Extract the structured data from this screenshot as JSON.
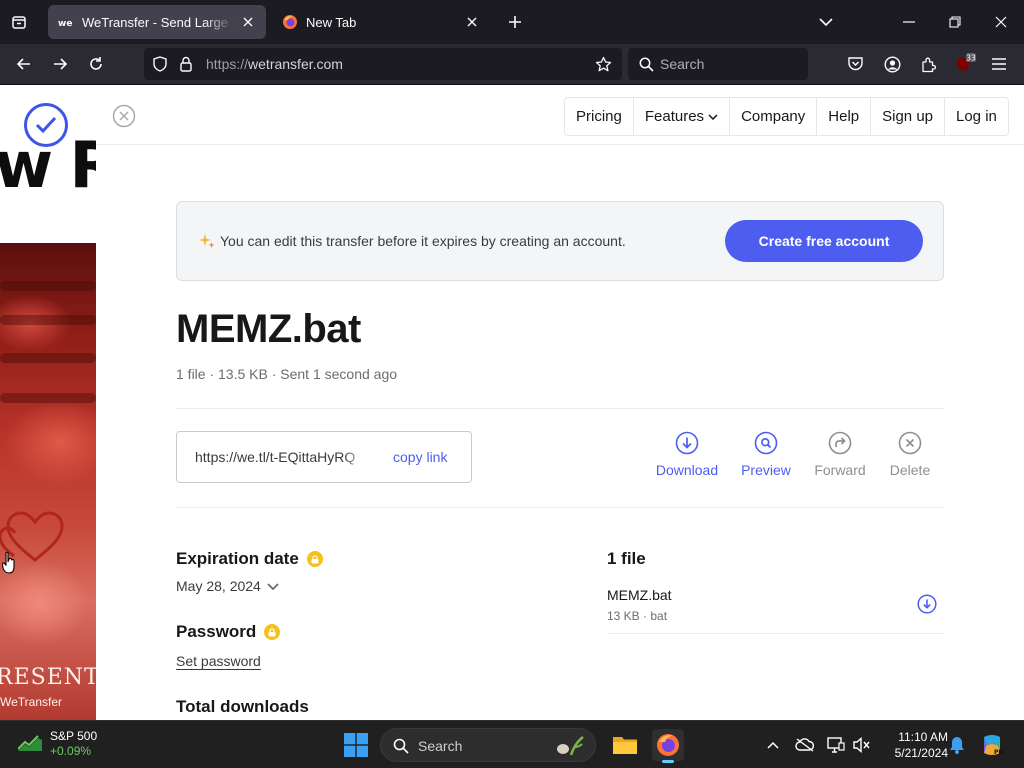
{
  "browser": {
    "tabs": [
      {
        "title": "WeTransfer - Send Large Files & Share Photos Online",
        "active": true,
        "favicon": "wetransfer-favicon"
      },
      {
        "title": "New Tab",
        "active": false,
        "favicon": "firefox-icon"
      }
    ],
    "url_scheme": "https://",
    "url_host": "wetransfer.com",
    "search_placeholder": "Search",
    "extensions_badge": "33"
  },
  "background": {
    "headline_fragment": "w R",
    "present_text": "RESENT",
    "present_sub": "WeTransfer"
  },
  "nav": {
    "items": [
      {
        "label": "Pricing",
        "has_dropdown": false
      },
      {
        "label": "Features",
        "has_dropdown": true
      },
      {
        "label": "Company",
        "has_dropdown": false
      },
      {
        "label": "Help",
        "has_dropdown": false
      },
      {
        "label": "Sign up",
        "has_dropdown": false
      },
      {
        "label": "Log in",
        "has_dropdown": false
      }
    ]
  },
  "banner": {
    "message": "You can edit this transfer before it expires by creating an account.",
    "cta": "Create free account"
  },
  "transfer": {
    "title": "MEMZ.bat",
    "meta": "1 file · 13.5 KB · Sent 1 second ago",
    "link": "https://we.tl/t-EQittaHyRQ",
    "copy_label": "copy link",
    "actions": [
      {
        "label": "Download",
        "icon": "download-icon",
        "enabled": true
      },
      {
        "label": "Preview",
        "icon": "preview-icon",
        "enabled": true
      },
      {
        "label": "Forward",
        "icon": "forward-icon",
        "enabled": false
      },
      {
        "label": "Delete",
        "icon": "delete-icon",
        "enabled": false
      }
    ]
  },
  "details": {
    "expiration_label": "Expiration date",
    "expiration_value": "May 28, 2024",
    "password_label": "Password",
    "password_action": "Set password",
    "downloads_label": "Total downloads"
  },
  "files": {
    "heading": "1 file",
    "items": [
      {
        "name": "MEMZ.bat",
        "meta": "13 KB · bat"
      }
    ]
  },
  "taskbar": {
    "widget_name": "S&P 500",
    "widget_value": "+0.09%",
    "search_placeholder": "Search",
    "time": "11:10 AM",
    "date": "5/21/2024"
  },
  "colors": {
    "accent": "#4d5df0",
    "lock_badge": "#f4c21a",
    "browser_dark": "#1c1b22"
  }
}
